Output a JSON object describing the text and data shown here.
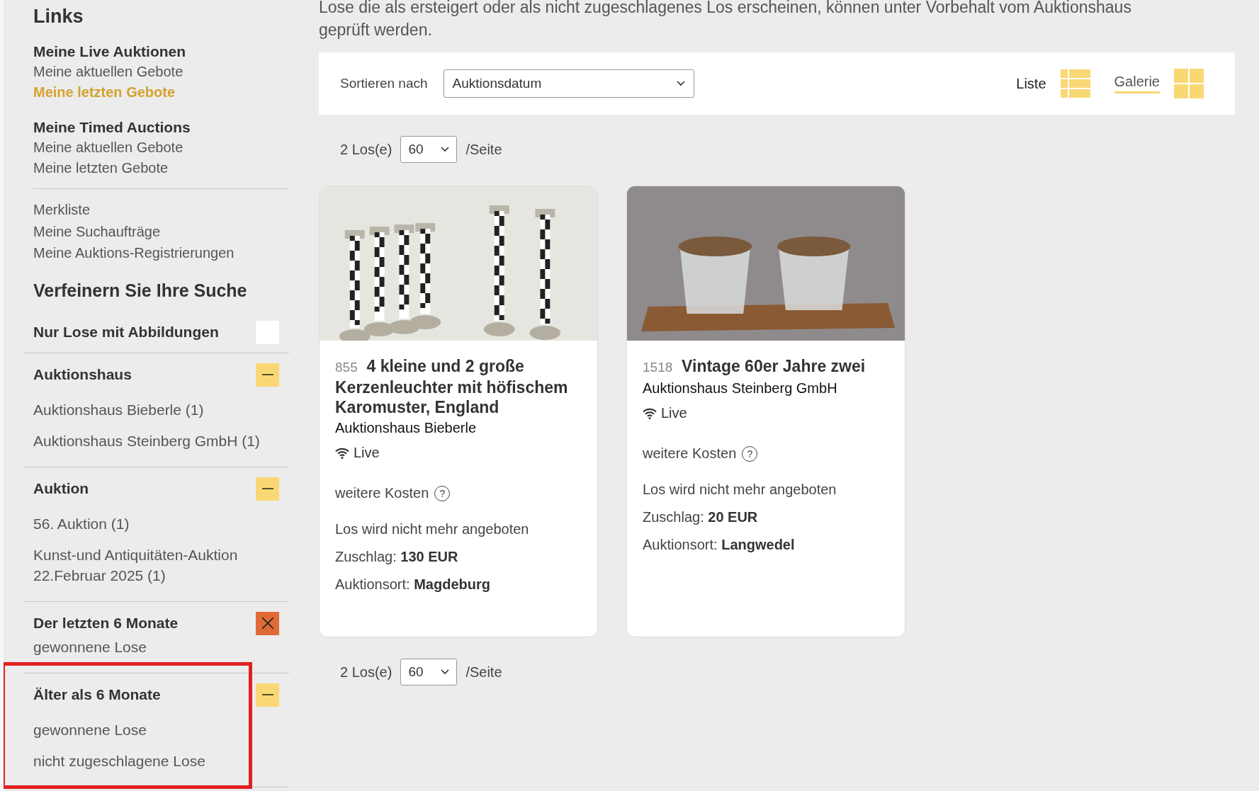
{
  "sidebar": {
    "title": "Links",
    "link_groups": [
      {
        "heading": "Meine Live Auktionen",
        "links": [
          {
            "label": "Meine aktuellen Gebote",
            "selected": false
          },
          {
            "label": "Meine letzten Gebote",
            "selected": true
          }
        ]
      },
      {
        "heading": "Meine Timed Auctions",
        "links": [
          {
            "label": "Meine aktuellen Gebote",
            "selected": false
          },
          {
            "label": "Meine letzten Gebote",
            "selected": false
          }
        ]
      }
    ],
    "more_links": [
      "Merkliste",
      "Meine Suchaufträge",
      "Meine Auktions-Registrierungen"
    ],
    "refine_title": "Verfeinern Sie Ihre Suche",
    "filters": [
      {
        "kind": "checkbox",
        "title": "Nur Lose mit Abbildungen",
        "checked": false
      },
      {
        "kind": "collapsible",
        "title": "Auktionshaus",
        "options": [
          "Auktionshaus Bieberle (1)",
          "Auktionshaus Steinberg GmbH (1)"
        ]
      },
      {
        "kind": "collapsible",
        "title": "Auktion",
        "options": [
          "56. Auktion (1)",
          "Kunst-und Antiquitäten-Auktion 22.Februar 2025 (1)"
        ]
      },
      {
        "kind": "removable",
        "title": "Der letzten 6 Monate",
        "options": [
          "gewonnene Lose"
        ]
      },
      {
        "kind": "collapsible",
        "title": "Älter als 6 Monate",
        "options": [
          "gewonnene Lose",
          "nicht zugeschlagene Lose"
        ],
        "highlighted": true
      }
    ]
  },
  "intro": "Lose die als ersteigert oder als nicht zugeschlagenes Los erscheinen, können unter Vorbehalt vom Auktionshaus geprüft werden.",
  "toolbar": {
    "sort_label": "Sortieren nach",
    "sort_value": "Auktionsdatum",
    "views": [
      {
        "label": "Liste",
        "kind": "list",
        "selected": false
      },
      {
        "label": "Galerie",
        "kind": "gallery",
        "selected": true
      }
    ]
  },
  "pager_top": {
    "count": "2 Los(e)",
    "per_page": "60",
    "suffix": "/Seite"
  },
  "lots": [
    {
      "number": "855",
      "title": "4 kleine und 2 große Kerzenleuchter mit höfischem Karomuster, England",
      "house": "Auktionshaus Bieberle",
      "mode": "Live",
      "costs": "weitere Kosten",
      "status": "Los wird nicht mehr angeboten",
      "price_label": "Zuschlag:",
      "price": "130 EUR",
      "place_label": "Auktionsort:",
      "place": "Magdeburg",
      "kind": "candlesticks",
      "help": "?"
    },
    {
      "number": "1518",
      "title": "Vintage 60er Jahre zwei",
      "house": "Auktionshaus Steinberg GmbH",
      "mode": "Live",
      "costs": "weitere Kosten",
      "status": "Los wird nicht mehr angeboten",
      "price_label": "Zuschlag:",
      "price": "20 EUR",
      "place_label": "Auktionsort:",
      "place": "Langwedel",
      "kind": "glasses",
      "help": "?"
    }
  ],
  "pager_bottom": {
    "count": "2 Los(e)",
    "per_page": "60",
    "suffix": "/Seite"
  }
}
